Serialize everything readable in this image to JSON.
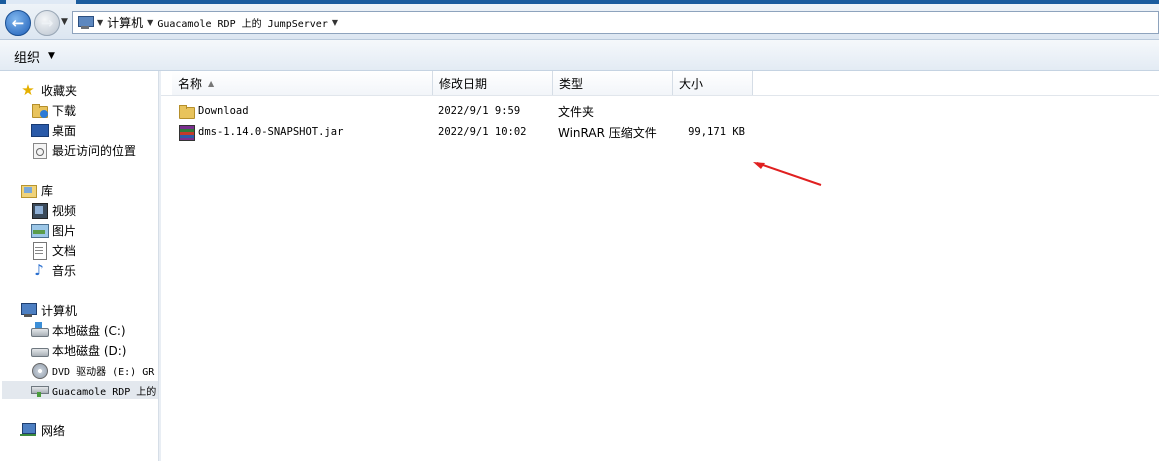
{
  "address": {
    "crumbs": [
      "计算机",
      "Guacamole RDP 上的 JumpServer"
    ]
  },
  "toolbar": {
    "organize_label": "组织"
  },
  "navpane": {
    "favorites": {
      "label": "收藏夹",
      "items": [
        {
          "label": "下载",
          "icon": "downloads-folder-icon"
        },
        {
          "label": "桌面",
          "icon": "desktop-icon"
        },
        {
          "label": "最近访问的位置",
          "icon": "recent-places-icon"
        }
      ]
    },
    "libraries": {
      "label": "库",
      "items": [
        {
          "label": "视频",
          "icon": "videos-icon"
        },
        {
          "label": "图片",
          "icon": "pictures-icon"
        },
        {
          "label": "文档",
          "icon": "documents-icon"
        },
        {
          "label": "音乐",
          "icon": "music-icon"
        }
      ]
    },
    "computer": {
      "label": "计算机",
      "items": [
        {
          "label": "本地磁盘 (C:)",
          "icon": "system-drive-icon"
        },
        {
          "label": "本地磁盘 (D:)",
          "icon": "drive-icon"
        },
        {
          "label": "DVD 驱动器 (E:) GR",
          "icon": "dvd-drive-icon"
        },
        {
          "label": "Guacamole RDP 上的",
          "icon": "network-drive-icon",
          "selected": true
        }
      ]
    },
    "network": {
      "label": "网络"
    }
  },
  "columns": {
    "name": "名称",
    "modified": "修改日期",
    "type": "类型",
    "size": "大小"
  },
  "files": [
    {
      "name": "Download",
      "modified": "2022/9/1 9:59",
      "type": "文件夹",
      "size": "",
      "icon": "folder-icon"
    },
    {
      "name": "dms-1.14.0-SNAPSHOT.jar",
      "modified": "2022/9/1 10:02",
      "type": "WinRAR 压缩文件",
      "size": "99,171 KB",
      "icon": "winrar-archive-icon"
    }
  ],
  "annotation": {
    "color": "#e02020"
  }
}
